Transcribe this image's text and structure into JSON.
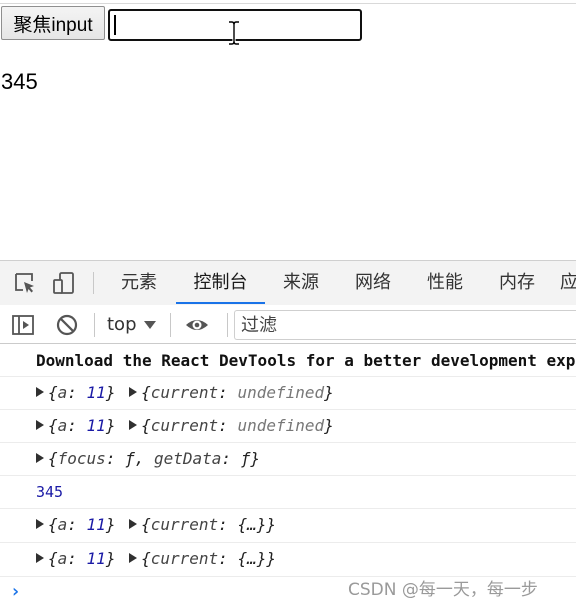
{
  "page": {
    "focus_button_label": "聚焦input",
    "input_value": "",
    "displayed_value": "345"
  },
  "devtools": {
    "tabs": [
      {
        "label": "元素"
      },
      {
        "label": "控制台"
      },
      {
        "label": "来源"
      },
      {
        "label": "网络"
      },
      {
        "label": "性能"
      },
      {
        "label": "内存"
      },
      {
        "label": "应"
      }
    ],
    "active_tab": "控制台",
    "accent_color": "#1a73e8",
    "toolbar": {
      "context": "top",
      "filter_placeholder": "过滤"
    },
    "icons": [
      "inspect-icon",
      "device-toggle-icon",
      "sidebar-toggle-icon",
      "clear-console-icon",
      "eye-icon"
    ]
  },
  "console": {
    "lines": [
      {
        "text": "Download the React DevTools for a better development experience"
      },
      {
        "obj1_key": "a",
        "obj1_value": "11",
        "obj2_key": "current",
        "obj2_value": "undefined"
      },
      {
        "obj1_key": "a",
        "obj1_value": "11",
        "obj2_key": "current",
        "obj2_value": "undefined"
      },
      {
        "key1": "focus",
        "val1": "ƒ",
        "key2": "getData",
        "val2": "ƒ"
      },
      {
        "text": "345"
      },
      {
        "obj1_key": "a",
        "obj1_value": "11",
        "obj2_key": "current",
        "obj2_value": "{…}"
      },
      {
        "obj1_key": "a",
        "obj1_value": "11",
        "obj2_key": "current",
        "obj2_value": "{…}"
      }
    ],
    "prompt_symbol": "›"
  },
  "watermark": "CSDN @每一天，每一步"
}
